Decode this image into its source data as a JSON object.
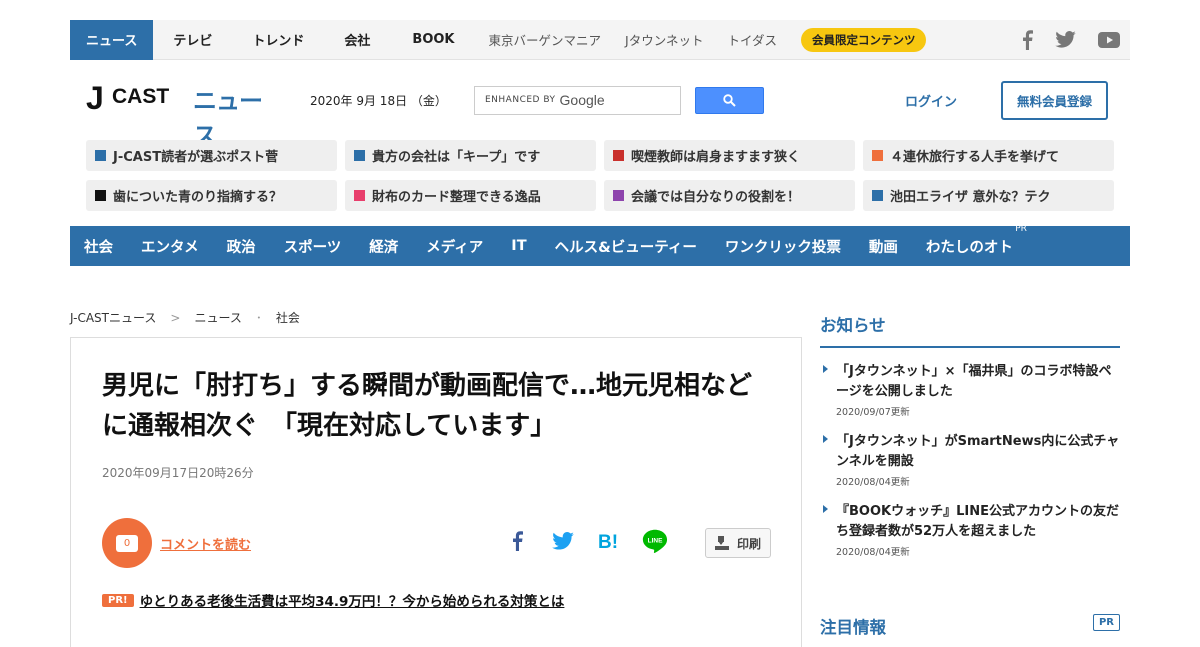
{
  "topnav": {
    "items": [
      {
        "label": "ニュース",
        "style": "active"
      },
      {
        "label": "テレビ",
        "style": "plain"
      },
      {
        "label": "トレンド",
        "style": "plain"
      },
      {
        "label": "会社",
        "style": "plain"
      },
      {
        "label": "BOOK",
        "style": "plain"
      },
      {
        "label": "東京バーゲンマニア",
        "style": "light"
      },
      {
        "label": "Jタウンネット",
        "style": "light"
      },
      {
        "label": "トイダス",
        "style": "light"
      }
    ],
    "member_button": "会員限定コンテンツ",
    "social_icons": [
      "facebook-icon",
      "twitter-icon",
      "youtube-icon"
    ]
  },
  "header": {
    "logo_j": "J",
    "logo_cast": "CAST",
    "logo_news": "ニュース",
    "date": "2020年 9月 18日 （金）",
    "search_enhanced": "ENHANCED BY",
    "search_google": "Google",
    "login": "ログイン",
    "signup": "無料会員登録"
  },
  "picks": [
    {
      "label": "J-CAST読者が選ぶポスト菅",
      "color": "#2d6fa8"
    },
    {
      "label": "貴方の会社は「キープ」です",
      "color": "#2d6fa8"
    },
    {
      "label": "喫煙教師は肩身ますます狭く",
      "color": "#c9302c"
    },
    {
      "label": "４連休旅行する人手を挙げて",
      "color": "#ef6f3c"
    },
    {
      "label": "歯についた青のり指摘する？",
      "color": "#111111"
    },
    {
      "label": "財布のカード整理できる逸品",
      "color": "#e83e6c"
    },
    {
      "label": "会議では自分なりの役割を！",
      "color": "#8e44ad"
    },
    {
      "label": "池田エライザ 意外な？テク",
      "color": "#2d6fa8"
    }
  ],
  "categories": [
    {
      "label": "社会"
    },
    {
      "label": "エンタメ"
    },
    {
      "label": "政治"
    },
    {
      "label": "スポーツ"
    },
    {
      "label": "経済"
    },
    {
      "label": "メディア"
    },
    {
      "label": "IT"
    },
    {
      "label": "ヘルス&ビューティー"
    },
    {
      "label": "ワンクリック投票"
    },
    {
      "label": "動画"
    },
    {
      "label": "わたしのオト",
      "pr": "PR"
    }
  ],
  "breadcrumb": [
    "J-CASTニュース",
    "ニュース",
    "社会"
  ],
  "article": {
    "title": "男児に「肘打ち」する瞬間が動画配信で…地元児相などに通報相次ぐ　「現在対応しています」",
    "timestamp": "2020年09月17日20時26分",
    "comment_count": "0",
    "comment_link": "コメントを読む",
    "print_label": "印刷",
    "pr_badge": "PR!",
    "pr_text": "ゆとりある老後生活費は平均34.9万円！？今から始められる対策とは"
  },
  "sidebar": {
    "heading": "お知らせ",
    "items": [
      {
        "title": "「Jタウンネット」×「福井県」のコラボ特設ページを公開しました",
        "date": "2020/09/07更新"
      },
      {
        "title": "「Jタウンネット」がSmartNews内に公式チャンネルを開設",
        "date": "2020/08/04更新"
      },
      {
        "title": "『BOOKウォッチ』LINE公式アカウントの友だち登録者数が52万人を超えました",
        "date": "2020/08/04更新"
      }
    ],
    "heading2": "注目情報",
    "heading2_pr": "PR"
  },
  "colors": {
    "brand_blue": "#2d6fa8",
    "accent_orange": "#ef6f3c",
    "member_yellow": "#f7c710",
    "google_blue": "#4d90fe",
    "line_green": "#00b900"
  }
}
